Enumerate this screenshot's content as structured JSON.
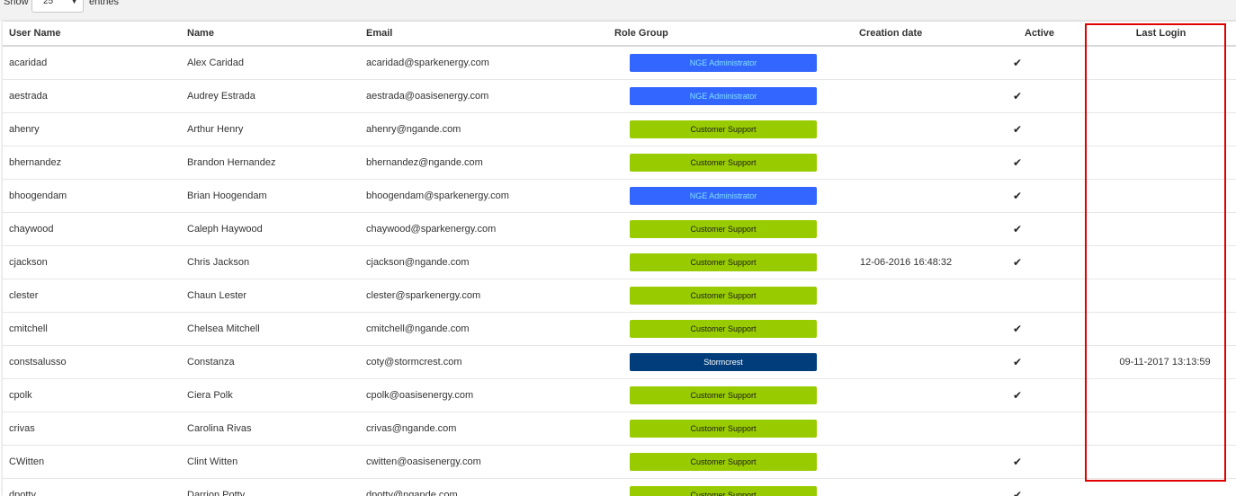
{
  "controls": {
    "show_label": "Show",
    "length_value": "25",
    "entries_label": "entries"
  },
  "table": {
    "headers": {
      "username": "User Name",
      "name": "Name",
      "email": "Email",
      "role_group": "Role Group",
      "creation_date": "Creation date",
      "active": "Active",
      "last_login": "Last Login"
    },
    "rows": [
      {
        "username": "acaridad",
        "name": "Alex Caridad",
        "email": "acaridad@sparkenergy.com",
        "role": "NGE Administrator",
        "role_type": "nge",
        "created": "",
        "active": "✔",
        "last_login": ""
      },
      {
        "username": "aestrada",
        "name": "Audrey Estrada",
        "email": "aestrada@oasisenergy.com",
        "role": "NGE Administrator",
        "role_type": "nge",
        "created": "",
        "active": "✔",
        "last_login": ""
      },
      {
        "username": "ahenry",
        "name": "Arthur Henry",
        "email": "ahenry@ngande.com",
        "role": "Customer Support",
        "role_type": "cs",
        "created": "",
        "active": "✔",
        "last_login": ""
      },
      {
        "username": "bhernandez",
        "name": "Brandon Hernandez",
        "email": "bhernandez@ngande.com",
        "role": "Customer Support",
        "role_type": "cs",
        "created": "",
        "active": "✔",
        "last_login": ""
      },
      {
        "username": "bhoogendam",
        "name": "Brian Hoogendam",
        "email": "bhoogendam@sparkenergy.com",
        "role": "NGE Administrator",
        "role_type": "nge",
        "created": "",
        "active": "✔",
        "last_login": ""
      },
      {
        "username": "chaywood",
        "name": "Caleph Haywood",
        "email": "chaywood@sparkenergy.com",
        "role": "Customer Support",
        "role_type": "cs",
        "created": "",
        "active": "✔",
        "last_login": ""
      },
      {
        "username": "cjackson",
        "name": "Chris Jackson",
        "email": "cjackson@ngande.com",
        "role": "Customer Support",
        "role_type": "cs",
        "created": "12-06-2016 16:48:32",
        "active": "✔",
        "last_login": ""
      },
      {
        "username": "clester",
        "name": "Chaun Lester",
        "email": "clester@sparkenergy.com",
        "role": "Customer Support",
        "role_type": "cs",
        "created": "",
        "active": "",
        "last_login": ""
      },
      {
        "username": "cmitchell",
        "name": "Chelsea Mitchell",
        "email": "cmitchell@ngande.com",
        "role": "Customer Support",
        "role_type": "cs",
        "created": "",
        "active": "✔",
        "last_login": ""
      },
      {
        "username": "constsalusso",
        "name": "Constanza",
        "email": "coty@stormcrest.com",
        "role": "Stormcrest",
        "role_type": "storm",
        "created": "",
        "active": "✔",
        "last_login": "09-11-2017 13:13:59"
      },
      {
        "username": "cpolk",
        "name": "Ciera Polk",
        "email": "cpolk@oasisenergy.com",
        "role": "Customer Support",
        "role_type": "cs",
        "created": "",
        "active": "✔",
        "last_login": ""
      },
      {
        "username": "crivas",
        "name": "Carolina Rivas",
        "email": "crivas@ngande.com",
        "role": "Customer Support",
        "role_type": "cs",
        "created": "",
        "active": "",
        "last_login": ""
      },
      {
        "username": "CWitten",
        "name": "Clint Witten",
        "email": "cwitten@oasisenergy.com",
        "role": "Customer Support",
        "role_type": "cs",
        "created": "",
        "active": "✔",
        "last_login": ""
      },
      {
        "username": "dpotty",
        "name": "Darrion Potty",
        "email": "dpotty@ngande.com",
        "role": "Customer Support",
        "role_type": "cs",
        "created": "",
        "active": "✔",
        "last_login": ""
      }
    ]
  },
  "colors": {
    "nge_badge": "#3366ff",
    "customer_support_badge": "#99cc00",
    "stormcrest_badge": "#003d7a",
    "highlight_box": "#e00000"
  }
}
